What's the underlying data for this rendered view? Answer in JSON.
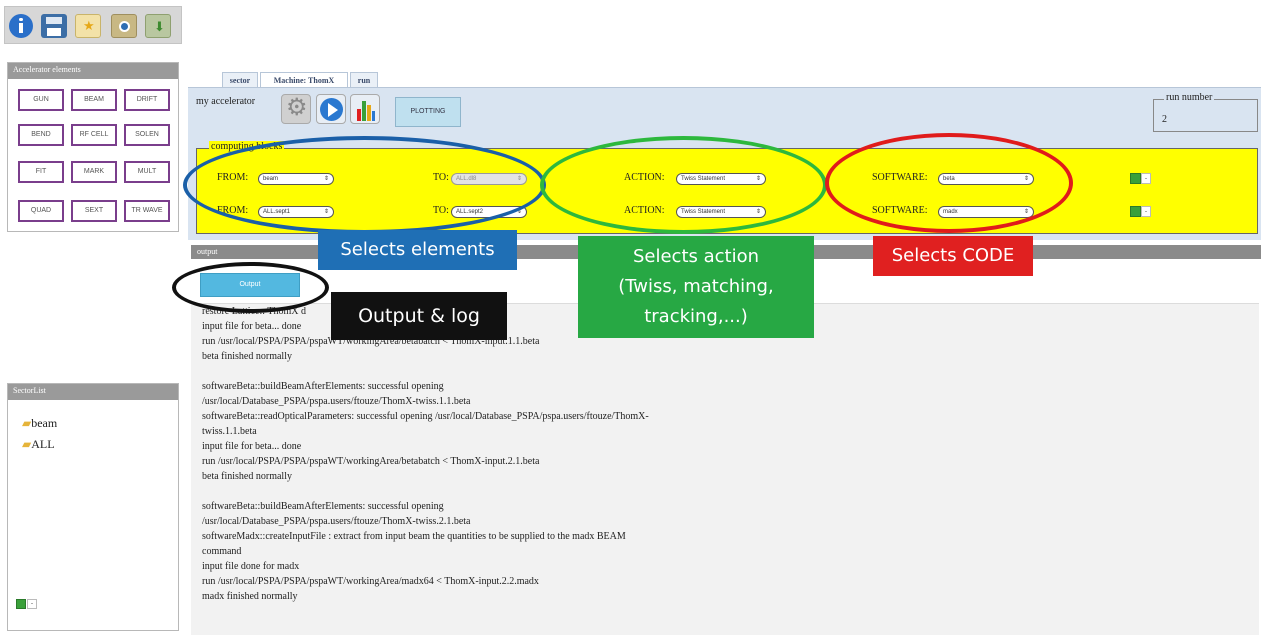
{
  "left": {
    "elements_title": "Accelerator elements",
    "buttons": [
      "GUN",
      "BEAM",
      "DRIFT",
      "BEND",
      "RF CELL",
      "SOLEN",
      "FIT",
      "MARK",
      "MULT",
      "QUAD",
      "SEXT",
      "TR WAVE"
    ],
    "sectorlist_title": "SectorList",
    "sectors": [
      "beam",
      "ALL"
    ]
  },
  "tabs": [
    "sector",
    "Machine: ThomX",
    "run"
  ],
  "header": {
    "my_accelerator": "my accelerator",
    "plotting": "PLOTTING",
    "run_number_label": "run number",
    "run_number_value": "2"
  },
  "computing": {
    "legend": "computing blocks",
    "from_label": "FROM:",
    "to_label": "TO:",
    "action_label": "ACTION:",
    "software_label": "SOFTWARE:",
    "rows": [
      {
        "from": "beam",
        "to": "ALL.dl8",
        "action": "Twiss Statement",
        "software": "beta"
      },
      {
        "from": "ALL.sept1",
        "to": "ALL.sept2",
        "action": "Twiss Statement",
        "software": "madx"
      }
    ]
  },
  "output": {
    "section_title": "output",
    "button": "Output",
    "log_top_partial": "restore Lattice:: ThomX d",
    "log_line_2_partial": "input file for beta... done",
    "log_lines": [
      "run /usr/local/PSPA/PSPA/pspaWT/workingArea/betabatch < ThomX-input.1.1.beta",
      "beta finished normally",
      "",
      "softwareBeta::buildBeamAfterElements: successful opening",
      "/usr/local/Database_PSPA/pspa.users/ftouze/ThomX-twiss.1.1.beta",
      "softwareBeta::readOpticalParameters: successful opening /usr/local/Database_PSPA/pspa.users/ftouze/ThomX-",
      "twiss.1.1.beta",
      "input file for beta... done",
      "run /usr/local/PSPA/PSPA/pspaWT/workingArea/betabatch < ThomX-input.2.1.beta",
      "beta finished normally",
      "",
      "softwareBeta::buildBeamAfterElements: successful opening",
      "/usr/local/Database_PSPA/pspa.users/ftouze/ThomX-twiss.2.1.beta",
      "softwareMadx::createInputFile : extract from input beam the quantities to be supplied to the madx BEAM",
      "command",
      "input file done for madx",
      "run /usr/local/PSPA/PSPA/pspaWT/workingArea/madx64 < ThomX-input.2.2.madx",
      "madx finished normally"
    ]
  },
  "callouts": {
    "elements": "Selects elements",
    "action": "Selects action\n(Twiss, matching,\ntracking,...)",
    "code": "Selects CODE",
    "output": "Output & log"
  },
  "colors": {
    "yellow": "#ffff00",
    "blue_callout": "#1f6fb5",
    "green_callout": "#27a844",
    "red_callout": "#e02020",
    "dark_callout": "#111111",
    "blue_ellipse": "#1a5fa8",
    "green_ellipse": "#2db83d",
    "red_ellipse": "#e01b1b"
  }
}
